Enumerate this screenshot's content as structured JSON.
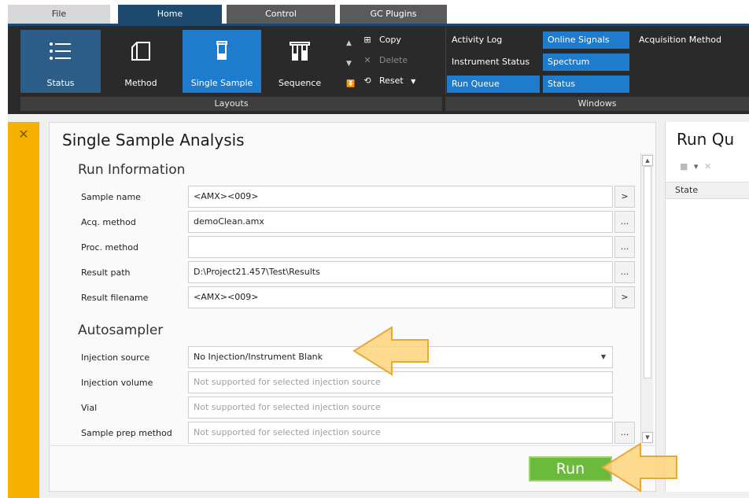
{
  "tabs": [
    {
      "label": "File"
    },
    {
      "label": "Home"
    },
    {
      "label": "Control"
    },
    {
      "label": "GC Plugins"
    }
  ],
  "ribbon": {
    "layouts_buttons": [
      {
        "label": "Status",
        "icon": "list-icon"
      },
      {
        "label": "Method",
        "icon": "book-icon"
      },
      {
        "label": "Single Sample",
        "icon": "vial-icon"
      },
      {
        "label": "Sequence",
        "icon": "sequence-icon"
      }
    ],
    "commands": [
      {
        "label": "Copy",
        "icon": "copy-icon",
        "enabled": true
      },
      {
        "label": "Delete",
        "icon": "delete-icon",
        "enabled": false
      },
      {
        "label": "Reset",
        "icon": "reset-icon",
        "enabled": true
      }
    ],
    "windows": [
      {
        "label": "Activity Log",
        "active": false
      },
      {
        "label": "Online Signals",
        "active": true
      },
      {
        "label": "Acquisition Method",
        "active": false
      },
      {
        "label": "Instrument Status",
        "active": false
      },
      {
        "label": "Spectrum",
        "active": true
      },
      {
        "label": "Run Queue",
        "active": true
      },
      {
        "label": "Status",
        "active": true
      }
    ],
    "groups": {
      "layouts": "Layouts",
      "windows": "Windows"
    },
    "colors": {
      "accent": "#1f7ccc",
      "ribbon_bg": "#2a2a2a",
      "rail": "#f6b100"
    }
  },
  "panel": {
    "title": "Single Sample Analysis",
    "run_info_title": "Run Information",
    "autosampler_title": "Autosampler",
    "fields": {
      "sample_name": {
        "label": "Sample name",
        "value": "<AMX><009>",
        "button": ">"
      },
      "acq_method": {
        "label": "Acq. method",
        "value": "demoClean.amx",
        "button": "..."
      },
      "proc_method": {
        "label": "Proc. method",
        "value": "",
        "button": "..."
      },
      "result_path": {
        "label": "Result path",
        "value": "D:\\Project21.457\\Test\\Results",
        "button": "..."
      },
      "result_filename": {
        "label": "Result filename",
        "value": "<AMX><009>",
        "button": ">"
      },
      "injection_source": {
        "label": "Injection source",
        "value": "No Injection/Instrument Blank"
      },
      "injection_volume": {
        "label": "Injection volume",
        "placeholder": "Not supported for selected injection source"
      },
      "vial": {
        "label": "Vial",
        "placeholder": "Not supported for selected injection source"
      },
      "sample_prep": {
        "label": "Sample prep method",
        "placeholder": "Not supported for selected injection source",
        "button": "..."
      }
    },
    "run_label": "Run"
  },
  "run_queue": {
    "title": "Run Qu",
    "column": "State"
  }
}
